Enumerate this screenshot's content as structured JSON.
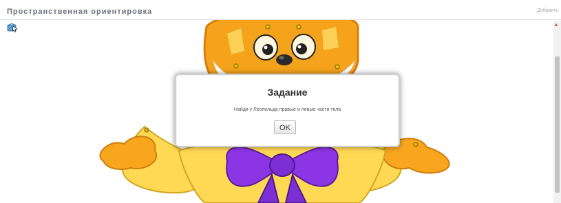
{
  "window": {
    "title": "Пространственная ориентировка",
    "top_right_link": "Добавить"
  },
  "toolbar": {
    "tool_icon": "cursor-map-icon"
  },
  "illustration": {
    "character": "cartoon-cat-leopold",
    "bow_color": "#8c35e5",
    "fur_color": "#f4a31b",
    "coat_color": "#ffd74f"
  },
  "dialog": {
    "title": "Задание",
    "message": "Найди у Леопольда правые и левые части тела",
    "ok_label": "OK"
  },
  "scrollbar": {
    "arrow_icon": "scroll-up-arrow-icon",
    "arrow_color": "#d03b3b"
  }
}
